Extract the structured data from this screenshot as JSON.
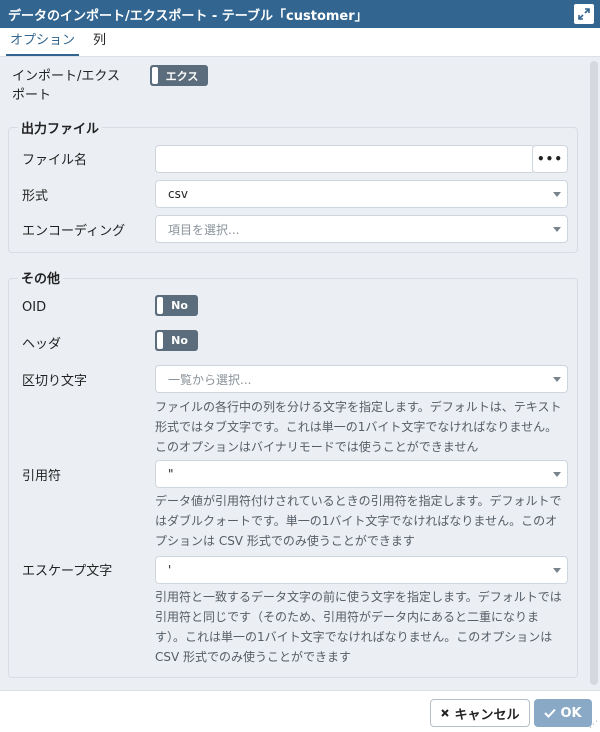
{
  "dialog": {
    "title": "データのインポート/エクスポート - テーブル「customer」"
  },
  "tabs": [
    {
      "label": "オプション",
      "active": true
    },
    {
      "label": "列",
      "active": false
    }
  ],
  "import_export": {
    "label": "インポート/エクスポート",
    "toggle": "エクス"
  },
  "output_file": {
    "legend": "出力ファイル",
    "filename_label": "ファイル名",
    "filename_value": "",
    "browse": "•••",
    "format_label": "形式",
    "format_value": "csv",
    "encoding_label": "エンコーディング",
    "encoding_placeholder": "項目を選択..."
  },
  "misc": {
    "legend": "その他",
    "oid_label": "OID",
    "oid_toggle": "No",
    "header_label": "ヘッダ",
    "header_toggle": "No",
    "delimiter_label": "区切り文字",
    "delimiter_placeholder": "一覧から選択...",
    "delimiter_help": "ファイルの各行中の列を分ける文字を指定します。デフォルトは、テキスト形式ではタブ文字です。これは単一の1バイト文字でなければなりません。このオプションはバイナリモードでは使うことができません",
    "quote_label": "引用符",
    "quote_value": "\"",
    "quote_help": "データ値が引用符付けされているときの引用符を指定します。デフォルトではダブルクォートです。単一の1バイト文字でなければなりません。このオプションは CSV 形式でのみ使うことができます",
    "escape_label": "エスケープ文字",
    "escape_value": "'",
    "escape_help": "引用符と一致するデータ文字の前に使う文字を指定します。デフォルトでは引用符と同じです（そのため、引用符がデータ内にあると二重になります）。これは単一の1バイト文字でなければなりません。このオプションは CSV 形式でのみ使うことができます"
  },
  "footer": {
    "cancel": "キャンセル",
    "ok": "OK"
  },
  "colors": {
    "titlebar": "#326690",
    "ok_button": "#8aa9c6",
    "toggle": "#5b6d7c"
  }
}
